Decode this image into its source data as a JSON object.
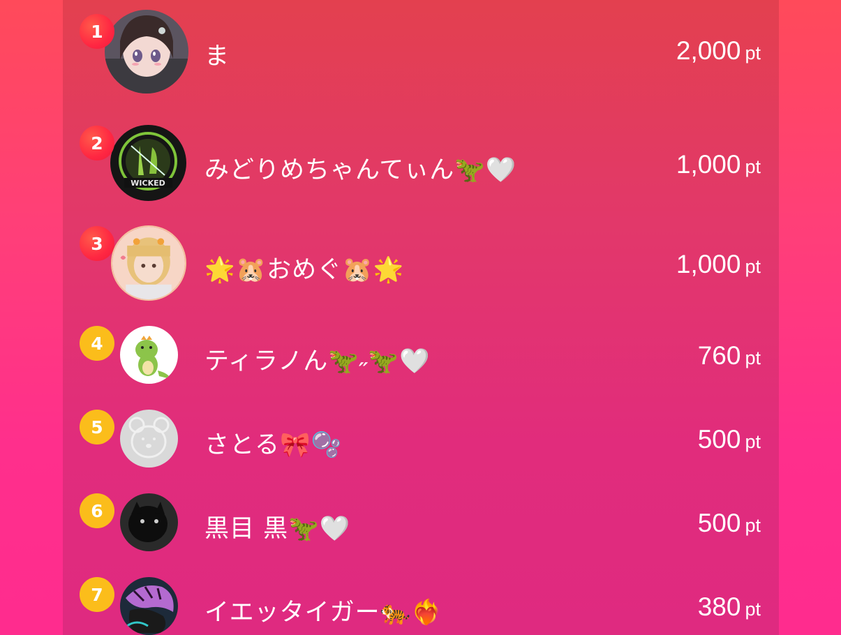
{
  "colors": {
    "background": "#ff3f78",
    "panel": "#e2386a",
    "badge_top": "#ff2742",
    "badge_other": "#fbbd1b",
    "text": "#ffffff"
  },
  "ranking": [
    {
      "rank": "1",
      "name": "ま",
      "points": "2,000",
      "unit": "pt",
      "avatar_icon": "anime-girl-avatar-icon"
    },
    {
      "rank": "2",
      "name": "みどりめちゃんてぃん🦖🤍",
      "points": "1,000",
      "unit": "pt",
      "avatar_icon": "wicked-logo-avatar-icon"
    },
    {
      "rank": "3",
      "name": "🌟🐹おめぐ🐹🌟",
      "points": "1,000",
      "unit": "pt",
      "avatar_icon": "blonde-girl-avatar-icon"
    },
    {
      "rank": "4",
      "name": "ティラノん🦖˶🦖🤍",
      "points": "760",
      "unit": "pt",
      "avatar_icon": "dinosaur-avatar-icon"
    },
    {
      "rank": "5",
      "name": "さとる🎀🫧",
      "points": "500",
      "unit": "pt",
      "avatar_icon": "bear-avatar-icon"
    },
    {
      "rank": "6",
      "name": "黒目 黒🦖🤍",
      "points": "500",
      "unit": "pt",
      "avatar_icon": "black-cat-avatar-icon"
    },
    {
      "rank": "7",
      "name": "イエッタイガー🐅❤️‍🔥",
      "points": "380",
      "unit": "pt",
      "avatar_icon": "purple-tiger-avatar-icon"
    }
  ]
}
